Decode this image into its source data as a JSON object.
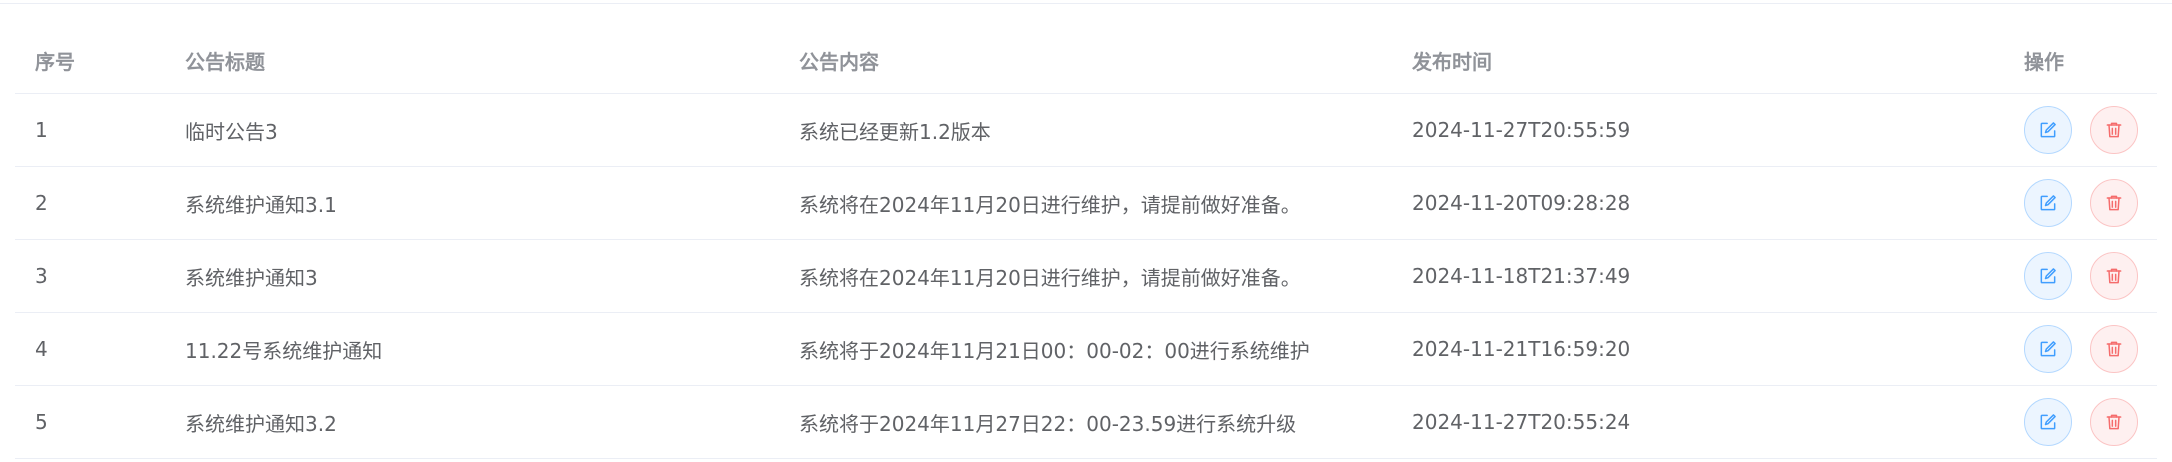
{
  "table": {
    "columns": {
      "index": "序号",
      "title": "公告标题",
      "content": "公告内容",
      "time": "发布时间",
      "actions": "操作"
    },
    "rows": [
      {
        "index": "1",
        "title": "临时公告3",
        "content": "系统已经更新1.2版本",
        "time": "2024-11-27T20:55:59"
      },
      {
        "index": "2",
        "title": "系统维护通知3.1",
        "content": "系统将在2024年11月20日进行维护，请提前做好准备。",
        "time": "2024-11-20T09:28:28"
      },
      {
        "index": "3",
        "title": "系统维护通知3",
        "content": "系统将在2024年11月20日进行维护，请提前做好准备。",
        "time": "2024-11-18T21:37:49"
      },
      {
        "index": "4",
        "title": "11.22号系统维护通知",
        "content": "系统将于2024年11月21日00：00-02：00进行系统维护",
        "time": "2024-11-21T16:59:20"
      },
      {
        "index": "5",
        "title": "系统维护通知3.2",
        "content": "系统将于2024年11月27日22：00-23.59进行系统升级",
        "time": "2024-11-27T20:55:24"
      }
    ]
  },
  "icons": {
    "edit": "edit-icon",
    "delete": "trash-icon"
  },
  "colors": {
    "edit_accent": "#409eff",
    "delete_accent": "#f56c6c",
    "header_text": "#909399",
    "body_text": "#606266"
  }
}
